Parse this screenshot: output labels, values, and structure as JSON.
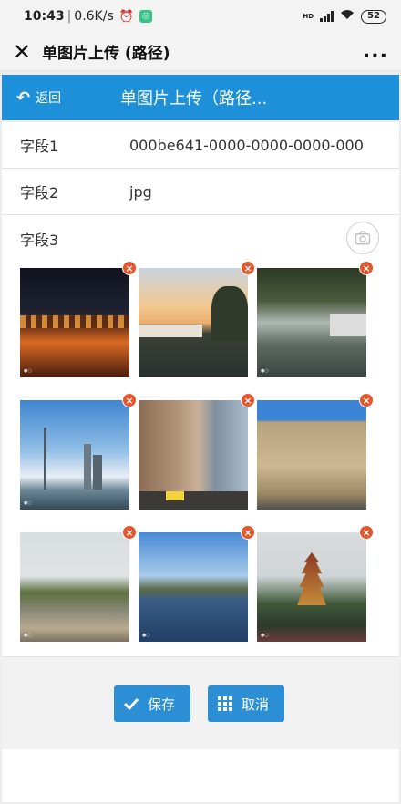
{
  "status_bar": {
    "time": "10:43",
    "speed": "0.6K/s",
    "network": "HD",
    "battery": "52"
  },
  "title_bar": {
    "title": "单图片上传 (路径)",
    "more": "..."
  },
  "nav": {
    "back_label": "返回",
    "title": "单图片上传（路径..."
  },
  "fields": [
    {
      "label": "字段1",
      "value": "000be641-0000-0000-0000-000"
    },
    {
      "label": "字段2",
      "value": "jpg"
    },
    {
      "label": "字段3"
    }
  ],
  "photos": [
    {
      "name": "photo-night-canal-town",
      "subject": "night canal town"
    },
    {
      "name": "photo-sunset-water-town",
      "subject": "water town at sunset"
    },
    {
      "name": "photo-canal-trees",
      "subject": "canal with trees"
    },
    {
      "name": "photo-city-skyline",
      "subject": "city skyline with tower"
    },
    {
      "name": "photo-old-buildings-street",
      "subject": "old buildings street"
    },
    {
      "name": "photo-stone-wall",
      "subject": "ancient stone wall"
    },
    {
      "name": "photo-mountain-riverbed",
      "subject": "mountain riverbed"
    },
    {
      "name": "photo-lake-village",
      "subject": "lake village"
    },
    {
      "name": "photo-pagoda-tower",
      "subject": "pagoda tower"
    }
  ],
  "actions": {
    "save_label": "保存",
    "cancel_label": "取消"
  },
  "colors": {
    "nav_blue": "#1e90d9",
    "button_blue": "#2c8fd6",
    "delete_red": "#e8552a"
  }
}
